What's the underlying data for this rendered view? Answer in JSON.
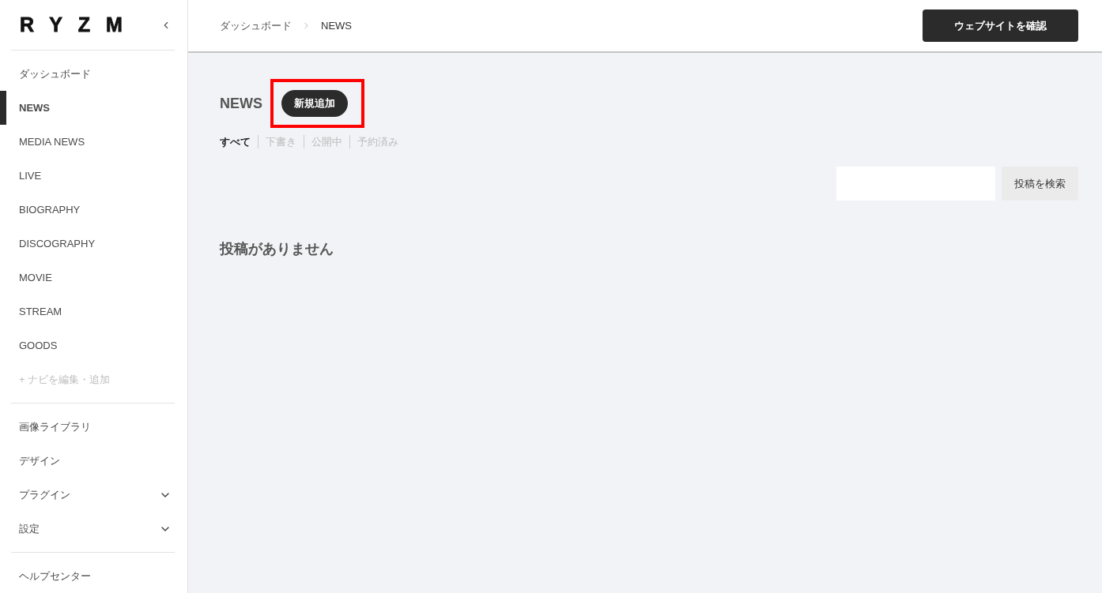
{
  "sidebar": {
    "logo": "RYZM",
    "nav_items": [
      {
        "label": "ダッシュボード",
        "selected": false
      },
      {
        "label": "NEWS",
        "selected": true
      },
      {
        "label": "MEDIA NEWS",
        "selected": false
      },
      {
        "label": "LIVE",
        "selected": false
      },
      {
        "label": "BIOGRAPHY",
        "selected": false
      },
      {
        "label": "DISCOGRAPHY",
        "selected": false
      },
      {
        "label": "MOVIE",
        "selected": false
      },
      {
        "label": "STREAM",
        "selected": false
      },
      {
        "label": "GOODS",
        "selected": false
      }
    ],
    "edit_nav_link": "+ ナビを編集・追加",
    "tool_items": [
      {
        "label": "画像ライブラリ",
        "kind": "link"
      },
      {
        "label": "デザイン",
        "kind": "link"
      },
      {
        "label": "プラグイン",
        "kind": "group"
      },
      {
        "label": "設定",
        "kind": "group"
      }
    ],
    "help_link": "ヘルプセンター"
  },
  "header": {
    "breadcrumb": [
      "ダッシュボード",
      "NEWS"
    ],
    "view_site_button": "ウェブサイトを確認"
  },
  "content": {
    "title": "NEWS",
    "add_button": {
      "label": "新規追加",
      "highlighted": true
    },
    "filters": [
      {
        "label": "すべて",
        "selected": true
      },
      {
        "label": "下書き",
        "selected": false
      },
      {
        "label": "公開中",
        "selected": false
      },
      {
        "label": "予約済み",
        "selected": false
      }
    ],
    "search_button": "投稿を検索",
    "empty_message": "投稿がありません"
  }
}
